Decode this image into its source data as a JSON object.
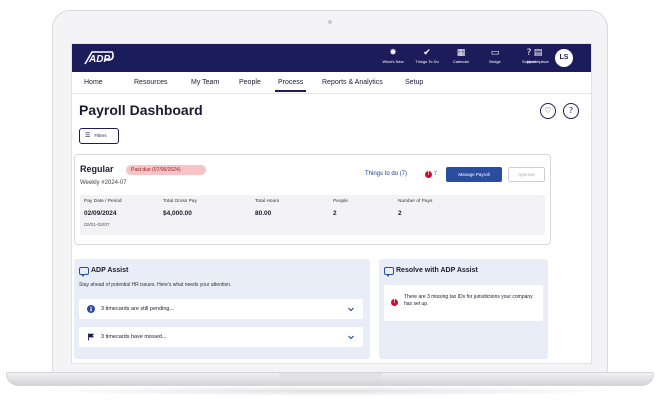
{
  "brand": {
    "logo_text": "ADP",
    "navy": "#1c1c5a",
    "accent": "#2a4da0",
    "alert": "#c8102e"
  },
  "topbar": {
    "items": [
      {
        "label": "What's New",
        "icon": "sparkle-icon"
      },
      {
        "label": "Things To Do",
        "icon": "check-circle-icon"
      },
      {
        "label": "Calendar",
        "icon": "calendar-icon"
      },
      {
        "label": "Bridge",
        "icon": "chat-bridge-icon"
      },
      {
        "label": "Support",
        "icon": "help-icon"
      },
      {
        "label": "Marketplace",
        "icon": "marketplace-icon"
      }
    ],
    "avatar_initials": "LS"
  },
  "nav": {
    "items": [
      "Home",
      "Resources",
      "My Team",
      "People",
      "Process",
      "Reports & Analytics",
      "Setup"
    ],
    "active": "Process"
  },
  "header": {
    "title": "Payroll Dashboard",
    "filters_label": "Filters"
  },
  "payroll": {
    "title": "Regular",
    "badge": "Past due (07/06/2024)",
    "subtitle": "Weekly #2024-07",
    "things_to_do": "Things to do (7)",
    "alert_count": "7",
    "manage_label": "Manage Payroll",
    "approve_label": "Approve",
    "columns": [
      {
        "header": "Pay Date / Period",
        "value": "02/09/2024",
        "sub": "02/01-02/07"
      },
      {
        "header": "Total Gross Pay",
        "value": "$4,000.00"
      },
      {
        "header": "Total Hours",
        "value": "80.00"
      },
      {
        "header": "People",
        "value": "2"
      },
      {
        "header": "Number of Pays",
        "value": "2"
      }
    ]
  },
  "assist": {
    "title": "ADP Assist",
    "subtitle": "Stay ahead of potential HR issues. Here's what needs your attention.",
    "items": [
      {
        "text": "3 timecards are still pending...",
        "icon": "info-icon"
      },
      {
        "text": "3 timecards have missed...",
        "icon": "flag-icon"
      }
    ]
  },
  "resolve": {
    "title": "Resolve with ADP Assist",
    "message": "There are 3 missing tax IDs for jurisdictions your company has set up."
  }
}
